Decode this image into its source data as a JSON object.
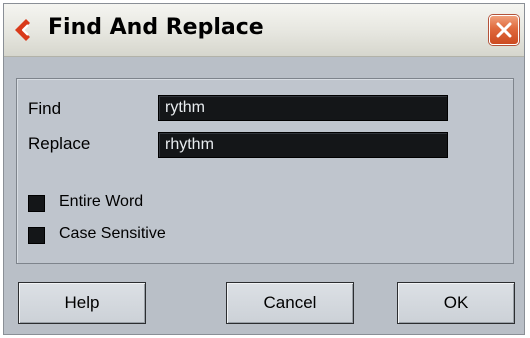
{
  "window": {
    "title": "Find And Replace",
    "app_icon": "cubase-logo-icon",
    "close_icon": "close-icon"
  },
  "form": {
    "find_label": "Find",
    "find_value": "rythm",
    "replace_label": "Replace",
    "replace_value": "rhythm",
    "options": [
      {
        "label": "Entire Word",
        "checked": false
      },
      {
        "label": "Case Sensitive",
        "checked": false
      }
    ]
  },
  "buttons": {
    "help": "Help",
    "cancel": "Cancel",
    "ok": "OK"
  },
  "colors": {
    "accent": "#d93a1a",
    "field_bg": "#141618",
    "panel_bg": "#bfc5cd",
    "window_bg": "#b9bfc7"
  }
}
